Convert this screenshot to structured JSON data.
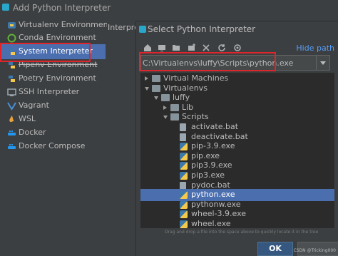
{
  "outer_dialog": {
    "title": "Add Python Interpreter",
    "interpreter_label": "Interpre"
  },
  "sidebar": {
    "items": [
      {
        "label": "Virtualenv Environment",
        "icon": "virtualenv-icon"
      },
      {
        "label": "Conda Environment",
        "icon": "conda-icon"
      },
      {
        "label": "System Interpreter",
        "icon": "python-icon",
        "selected": true
      },
      {
        "label": "Pipenv Environment",
        "icon": "pipenv-icon"
      },
      {
        "label": "Poetry Environment",
        "icon": "poetry-icon"
      },
      {
        "label": "SSH Interpreter",
        "icon": "ssh-icon"
      },
      {
        "label": "Vagrant",
        "icon": "vagrant-icon"
      },
      {
        "label": "WSL",
        "icon": "wsl-icon"
      },
      {
        "label": "Docker",
        "icon": "docker-icon"
      },
      {
        "label": "Docker Compose",
        "icon": "docker-compose-icon"
      }
    ]
  },
  "select_dialog": {
    "title": "Select Python Interpreter",
    "hide_path": "Hide path",
    "path_value": "C:\\Virtualenvs\\luffy\\Scripts\\python.exe",
    "hint": "Drag and drop a file into the space above to quickly locate it in the tree",
    "ok_label": "OK"
  },
  "tree": {
    "rows": [
      {
        "label": "Virtual Machines",
        "type": "folder",
        "level": 0,
        "expand": "closed"
      },
      {
        "label": "Virtualenvs",
        "type": "folder",
        "level": 0,
        "expand": "open"
      },
      {
        "label": "luffy",
        "type": "folder",
        "level": 1,
        "expand": "open"
      },
      {
        "label": "Lib",
        "type": "folder",
        "level": 2,
        "expand": "closed"
      },
      {
        "label": "Scripts",
        "type": "folder",
        "level": 2,
        "expand": "open"
      },
      {
        "label": "activate.bat",
        "type": "file",
        "level": 3
      },
      {
        "label": "deactivate.bat",
        "type": "file",
        "level": 3
      },
      {
        "label": "pip-3.9.exe",
        "type": "py",
        "level": 3
      },
      {
        "label": "pip.exe",
        "type": "py",
        "level": 3
      },
      {
        "label": "pip3.9.exe",
        "type": "py",
        "level": 3
      },
      {
        "label": "pip3.exe",
        "type": "py",
        "level": 3
      },
      {
        "label": "pydoc.bat",
        "type": "file",
        "level": 3
      },
      {
        "label": "python.exe",
        "type": "py",
        "level": 3,
        "selected": true
      },
      {
        "label": "pythonw.exe",
        "type": "py",
        "level": 3
      },
      {
        "label": "wheel-3.9.exe",
        "type": "py",
        "level": 3
      },
      {
        "label": "wheel.exe",
        "type": "py",
        "level": 3
      }
    ]
  },
  "toolbar_icons": [
    "home-icon",
    "desktop-icon",
    "project-icon",
    "new-folder-icon",
    "delete-icon",
    "refresh-icon",
    "show-hidden-icon"
  ],
  "colors": {
    "selection": "#4b6eaf",
    "highlight_box": "#e0242a",
    "link": "#589df6"
  },
  "watermark": "CSDN @Tricking000"
}
